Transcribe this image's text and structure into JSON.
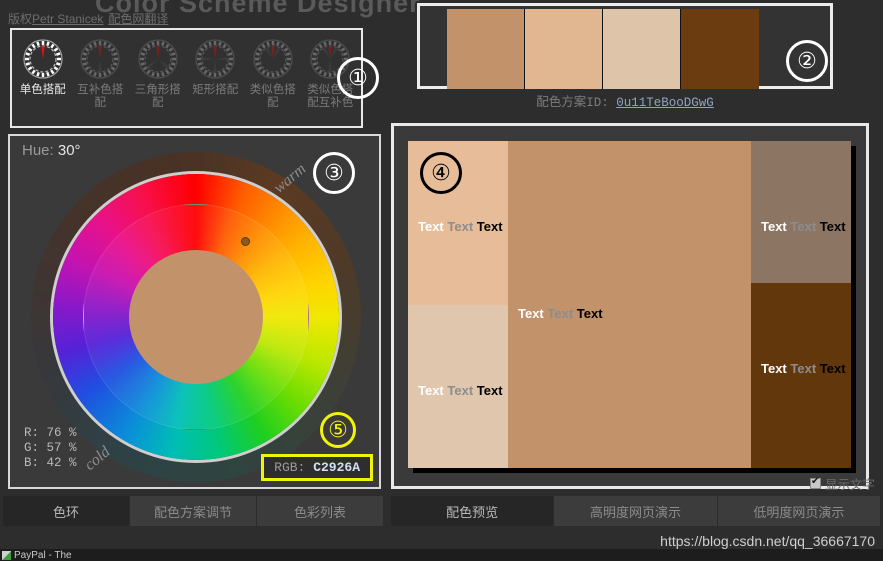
{
  "header": {
    "app_title": "Color Scheme Designer",
    "copyright_prefix": "版权",
    "author_link": "Petr Stanicek",
    "translator_link": "配色网翻译"
  },
  "schemes": {
    "items": [
      {
        "label": "单色搭配",
        "icon": "mono-wheel-icon",
        "active": true
      },
      {
        "label": "互补色搭配",
        "icon": "complement-wheel-icon",
        "active": false
      },
      {
        "label": "三角形搭配",
        "icon": "triad-wheel-icon",
        "active": false
      },
      {
        "label": "矩形搭配",
        "icon": "tetrad-wheel-icon",
        "active": false
      },
      {
        "label": "类似色搭配",
        "icon": "analogic-wheel-icon",
        "active": false
      },
      {
        "label": "类似色搭配互补色",
        "icon": "analogic-complement-wheel-icon",
        "active": false
      }
    ]
  },
  "palette": {
    "swatches": [
      "#C2926A",
      "#E0B791",
      "#DEC4A9",
      "#6B3C10"
    ],
    "scheme_id_label": "配色方案ID:",
    "scheme_id_value": "0u11TeBooDGwG"
  },
  "wheel": {
    "hue_label": "Hue:",
    "hue_value": "30°",
    "warm_label": "warm",
    "cold_label": "cold",
    "center_color": "#C2926A",
    "r_line": "R: 76 %",
    "g_line": "G: 57 %",
    "b_line": "B: 42 %",
    "rgb_key": "RGB:",
    "rgb_value": "C2926A",
    "highlight_color": "#F3F30A"
  },
  "preview": {
    "text_sample": [
      "Text",
      "Text",
      "Text"
    ],
    "blocks": [
      {
        "name": "left-top",
        "color": "#E7BD99"
      },
      {
        "name": "left-bottom",
        "color": "#DFC6AD"
      },
      {
        "name": "center",
        "color": "#C2926A"
      },
      {
        "name": "right-top",
        "color": "#8C7563"
      },
      {
        "name": "right-bottom",
        "color": "#63370C"
      }
    ],
    "show_text_label": "显示文字",
    "show_text_checked": true
  },
  "tabs_left": [
    {
      "label": "色环",
      "active": true
    },
    {
      "label": "配色方案调节",
      "active": false
    },
    {
      "label": "色彩列表",
      "active": false
    }
  ],
  "tabs_right": [
    {
      "label": "配色预览",
      "active": true
    },
    {
      "label": "高明度网页演示",
      "active": false
    },
    {
      "label": "低明度网页演示",
      "active": false
    }
  ],
  "annotations": {
    "one": "①",
    "two": "②",
    "three": "③",
    "four": "④",
    "five": "⑤"
  },
  "footer": {
    "watermark": "https://blog.csdn.net/qq_36667170",
    "taskbar_item": "PayPal - The"
  }
}
